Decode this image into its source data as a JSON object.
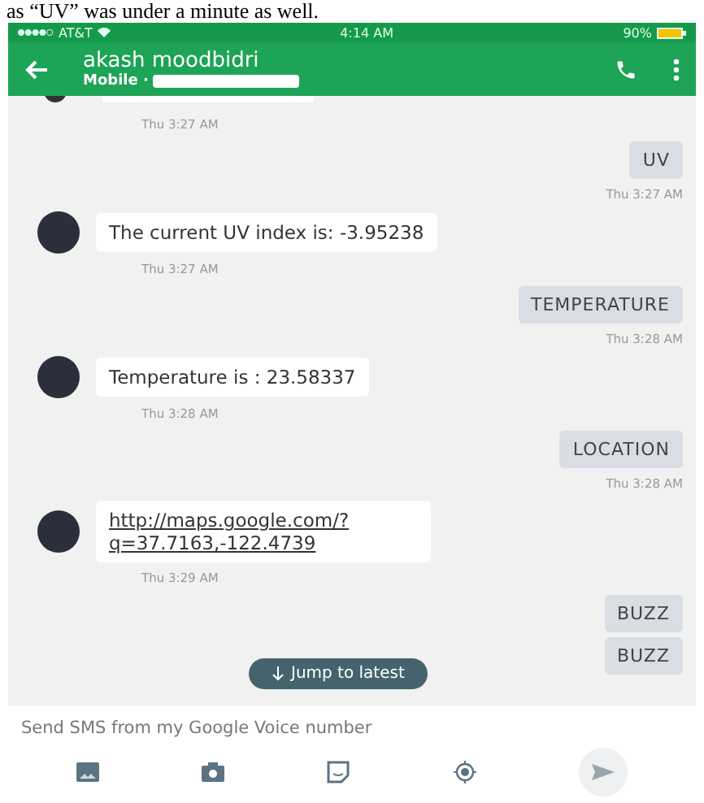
{
  "caption": "as “UV” was under a minute as well.",
  "status_bar": {
    "carrier": "AT&T",
    "time": "4:14 AM",
    "battery": "90%"
  },
  "header": {
    "name": "akash moodbidri",
    "subtitle": "Mobile ·"
  },
  "messages": [
    {
      "kind": "stub",
      "time": "Thu 3:27 AM"
    },
    {
      "kind": "outgoing",
      "text": "UV",
      "time": "Thu 3:27 AM"
    },
    {
      "kind": "incoming",
      "text": "The current UV index is: -3.95238",
      "time": "Thu 3:27 AM"
    },
    {
      "kind": "outgoing",
      "text": "TEMPERATURE",
      "time": "Thu 3:28 AM"
    },
    {
      "kind": "incoming",
      "text": "Temperature is : 23.58337",
      "time": "Thu 3:28 AM"
    },
    {
      "kind": "outgoing",
      "text": "LOCATION",
      "time": "Thu 3:28 AM"
    },
    {
      "kind": "link",
      "text": "http://maps.google.com/?q=37.7163,-122.4739",
      "time": "Thu 3:29 AM"
    },
    {
      "kind": "outgoing",
      "text": "BUZZ"
    },
    {
      "kind": "outgoing",
      "text": "BUZZ"
    }
  ],
  "jump_button": "Jump to latest",
  "compose": {
    "placeholder": "Send SMS from my Google Voice number"
  }
}
